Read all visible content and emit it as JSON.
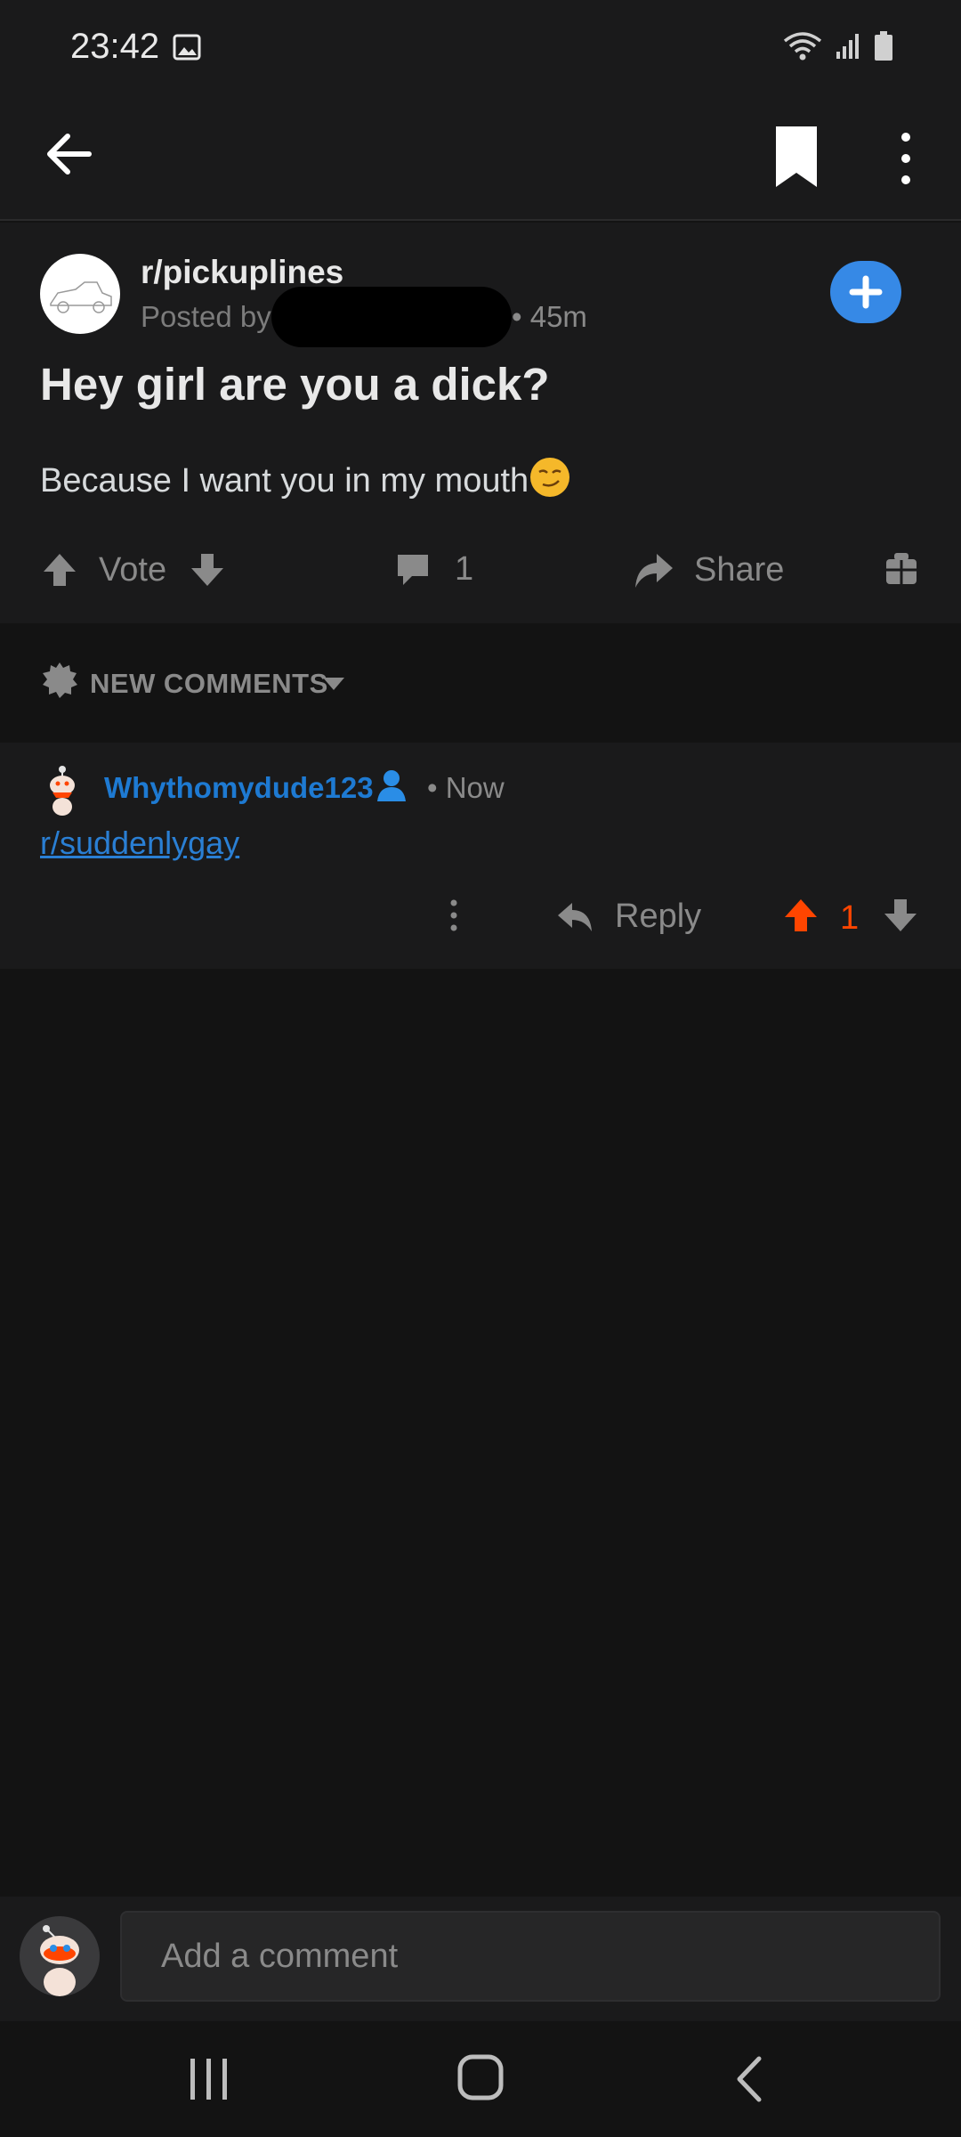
{
  "status_bar": {
    "time": "23:42"
  },
  "post": {
    "subreddit": "r/pickuplines",
    "posted_by_prefix": "Posted by",
    "time": "• 45m",
    "title": "Hey girl are you a dick?",
    "body": "Because I want you in my mouth",
    "vote_label": "Vote",
    "comment_count": "1",
    "share_label": "Share"
  },
  "sort": {
    "label": "NEW COMMENTS"
  },
  "comment": {
    "username": "Whythomydude123",
    "time": "• Now",
    "link_text": "r/suddenlygay",
    "reply_label": "Reply",
    "score": "1"
  },
  "comment_bar": {
    "placeholder": "Add a comment"
  },
  "colors": {
    "accent": "#3689e6",
    "upvote": "#ff4500",
    "username": "#1e7ad2",
    "background": "#131313",
    "surface": "#1a1a1b"
  }
}
